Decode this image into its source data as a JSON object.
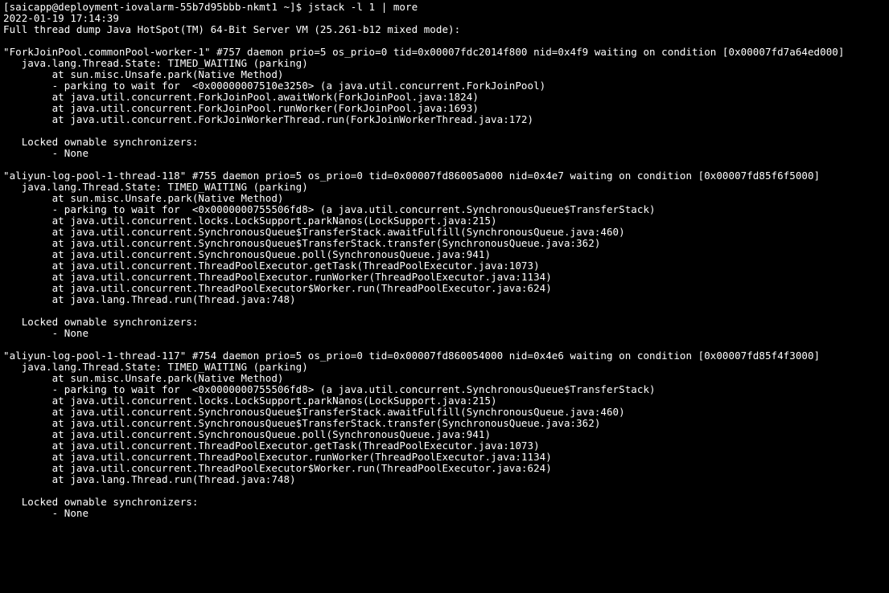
{
  "terminal": {
    "prompt": {
      "prompt": "[saicapp@deployment-iovalarm-55b7d95bbb-nkmt1 ~]$",
      "cmd": "jstack -l 1 | more"
    },
    "timestamp": "2022-01-19 17:14:39",
    "dump_header": "Full thread dump Java HotSpot(TM) 64-Bit Server VM (25.261-b12 mixed mode):",
    "threads": [
      {
        "header": "\"ForkJoinPool.commonPool-worker-1\" #757 daemon prio=5 os_prio=0 tid=0x00007fdc2014f800 nid=0x4f9 waiting on condition [0x00007fd7a64ed000]",
        "state": "   java.lang.Thread.State: TIMED_WAITING (parking)",
        "stack": [
          "        at sun.misc.Unsafe.park(Native Method)",
          "        - parking to wait for  <0x00000007510e3250> (a java.util.concurrent.ForkJoinPool)",
          "        at java.util.concurrent.ForkJoinPool.awaitWork(ForkJoinPool.java:1824)",
          "        at java.util.concurrent.ForkJoinPool.runWorker(ForkJoinPool.java:1693)",
          "        at java.util.concurrent.ForkJoinWorkerThread.run(ForkJoinWorkerThread.java:172)"
        ],
        "sync_header": "   Locked ownable synchronizers:",
        "sync_body": "        - None"
      },
      {
        "header": "\"aliyun-log-pool-1-thread-118\" #755 daemon prio=5 os_prio=0 tid=0x00007fd86005a000 nid=0x4e7 waiting on condition [0x00007fd85f6f5000]",
        "state": "   java.lang.Thread.State: TIMED_WAITING (parking)",
        "stack": [
          "        at sun.misc.Unsafe.park(Native Method)",
          "        - parking to wait for  <0x0000000755506fd8> (a java.util.concurrent.SynchronousQueue$TransferStack)",
          "        at java.util.concurrent.locks.LockSupport.parkNanos(LockSupport.java:215)",
          "        at java.util.concurrent.SynchronousQueue$TransferStack.awaitFulfill(SynchronousQueue.java:460)",
          "        at java.util.concurrent.SynchronousQueue$TransferStack.transfer(SynchronousQueue.java:362)",
          "        at java.util.concurrent.SynchronousQueue.poll(SynchronousQueue.java:941)",
          "        at java.util.concurrent.ThreadPoolExecutor.getTask(ThreadPoolExecutor.java:1073)",
          "        at java.util.concurrent.ThreadPoolExecutor.runWorker(ThreadPoolExecutor.java:1134)",
          "        at java.util.concurrent.ThreadPoolExecutor$Worker.run(ThreadPoolExecutor.java:624)",
          "        at java.lang.Thread.run(Thread.java:748)"
        ],
        "sync_header": "   Locked ownable synchronizers:",
        "sync_body": "        - None"
      },
      {
        "header": "\"aliyun-log-pool-1-thread-117\" #754 daemon prio=5 os_prio=0 tid=0x00007fd860054000 nid=0x4e6 waiting on condition [0x00007fd85f4f3000]",
        "state": "   java.lang.Thread.State: TIMED_WAITING (parking)",
        "stack": [
          "        at sun.misc.Unsafe.park(Native Method)",
          "        - parking to wait for  <0x0000000755506fd8> (a java.util.concurrent.SynchronousQueue$TransferStack)",
          "        at java.util.concurrent.locks.LockSupport.parkNanos(LockSupport.java:215)",
          "        at java.util.concurrent.SynchronousQueue$TransferStack.awaitFulfill(SynchronousQueue.java:460)",
          "        at java.util.concurrent.SynchronousQueue$TransferStack.transfer(SynchronousQueue.java:362)",
          "        at java.util.concurrent.SynchronousQueue.poll(SynchronousQueue.java:941)",
          "        at java.util.concurrent.ThreadPoolExecutor.getTask(ThreadPoolExecutor.java:1073)",
          "        at java.util.concurrent.ThreadPoolExecutor.runWorker(ThreadPoolExecutor.java:1134)",
          "        at java.util.concurrent.ThreadPoolExecutor$Worker.run(ThreadPoolExecutor.java:624)",
          "        at java.lang.Thread.run(Thread.java:748)"
        ],
        "sync_header": "   Locked ownable synchronizers:",
        "sync_body": "        - None"
      }
    ]
  }
}
